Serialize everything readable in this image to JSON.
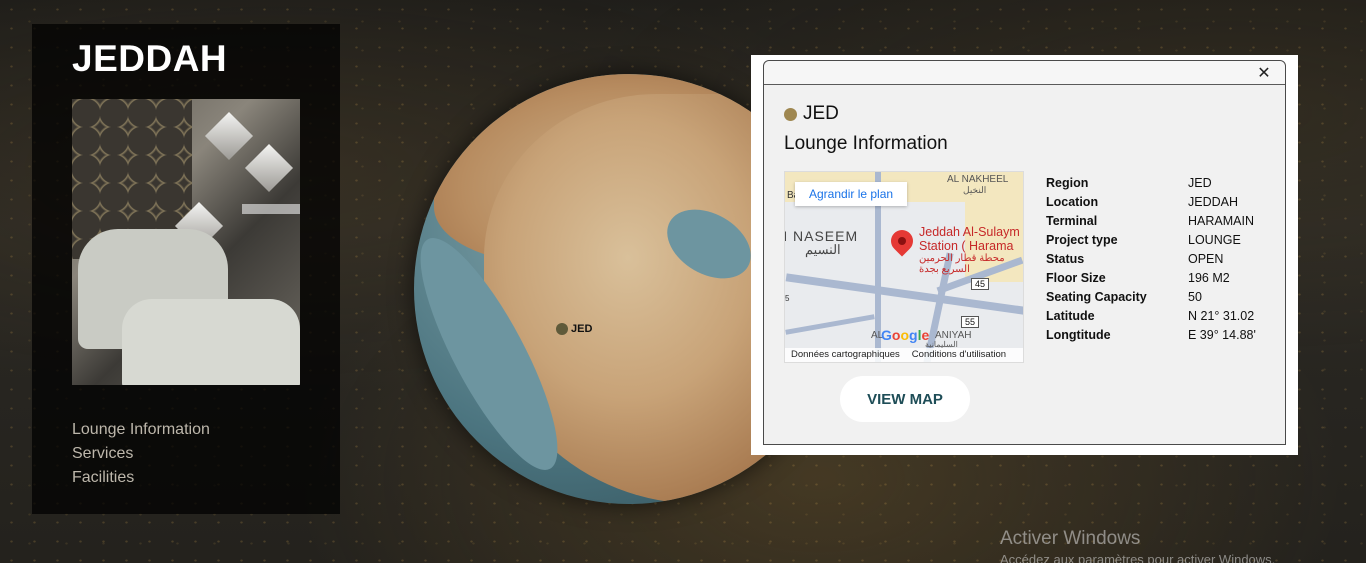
{
  "city": {
    "title": "JEDDAH"
  },
  "left_nav": {
    "items": [
      "Lounge Information",
      "Services",
      "Facilities"
    ]
  },
  "globe": {
    "marker_label": "JED"
  },
  "info_card": {
    "code": "JED",
    "heading": "Lounge Information",
    "close_icon": "close-icon",
    "map": {
      "enlarge_label": "Agrandir le plan",
      "area_label": "AL NAKHEEL",
      "area_label_ar": "النخيل",
      "district_label": "N NASEEM",
      "district_label_ar": "النسيم",
      "place_name_line1": "Jeddah Al-Sulaym",
      "place_name_line2": "Station (  Harama",
      "place_name_ar_line1": "محطة قطار الحرمين",
      "place_name_ar_line2": "السريع بجدة",
      "route_45": "45",
      "route_55": "55",
      "bottom_label": "AL",
      "bottom_label_right": "ANIYAH",
      "bottom_label_ar": "السليمانية",
      "left_edge_label": "Ba",
      "left_edge_label2": "5",
      "google": "Google",
      "footer_data": "Données cartographiques",
      "footer_terms": "Conditions d'utilisation",
      "pin_icon": "map-pin-icon"
    },
    "details": [
      {
        "key": "Region",
        "value": "JED"
      },
      {
        "key": "Location",
        "value": "JEDDAH"
      },
      {
        "key": "Terminal",
        "value": "HARAMAIN"
      },
      {
        "key": "Project type",
        "value": "LOUNGE"
      },
      {
        "key": "Status",
        "value": "OPEN"
      },
      {
        "key": "Floor Size",
        "value": "196 M2"
      },
      {
        "key": "Seating Capacity",
        "value": "50"
      },
      {
        "key": "Latitude",
        "value": "N 21° 31.02"
      },
      {
        "key": "Longtitude",
        "value": "E 39° 14.88'"
      }
    ],
    "view_map_label": "VIEW MAP"
  },
  "watermark": {
    "title": "Activer Windows",
    "subtitle": "Accédez aux paramètres pour activer Windows."
  },
  "colors": {
    "accent_dot": "#9f8750",
    "button_text": "#1e4d57",
    "map_link": "#1a73e8",
    "pin": "#e53935"
  }
}
